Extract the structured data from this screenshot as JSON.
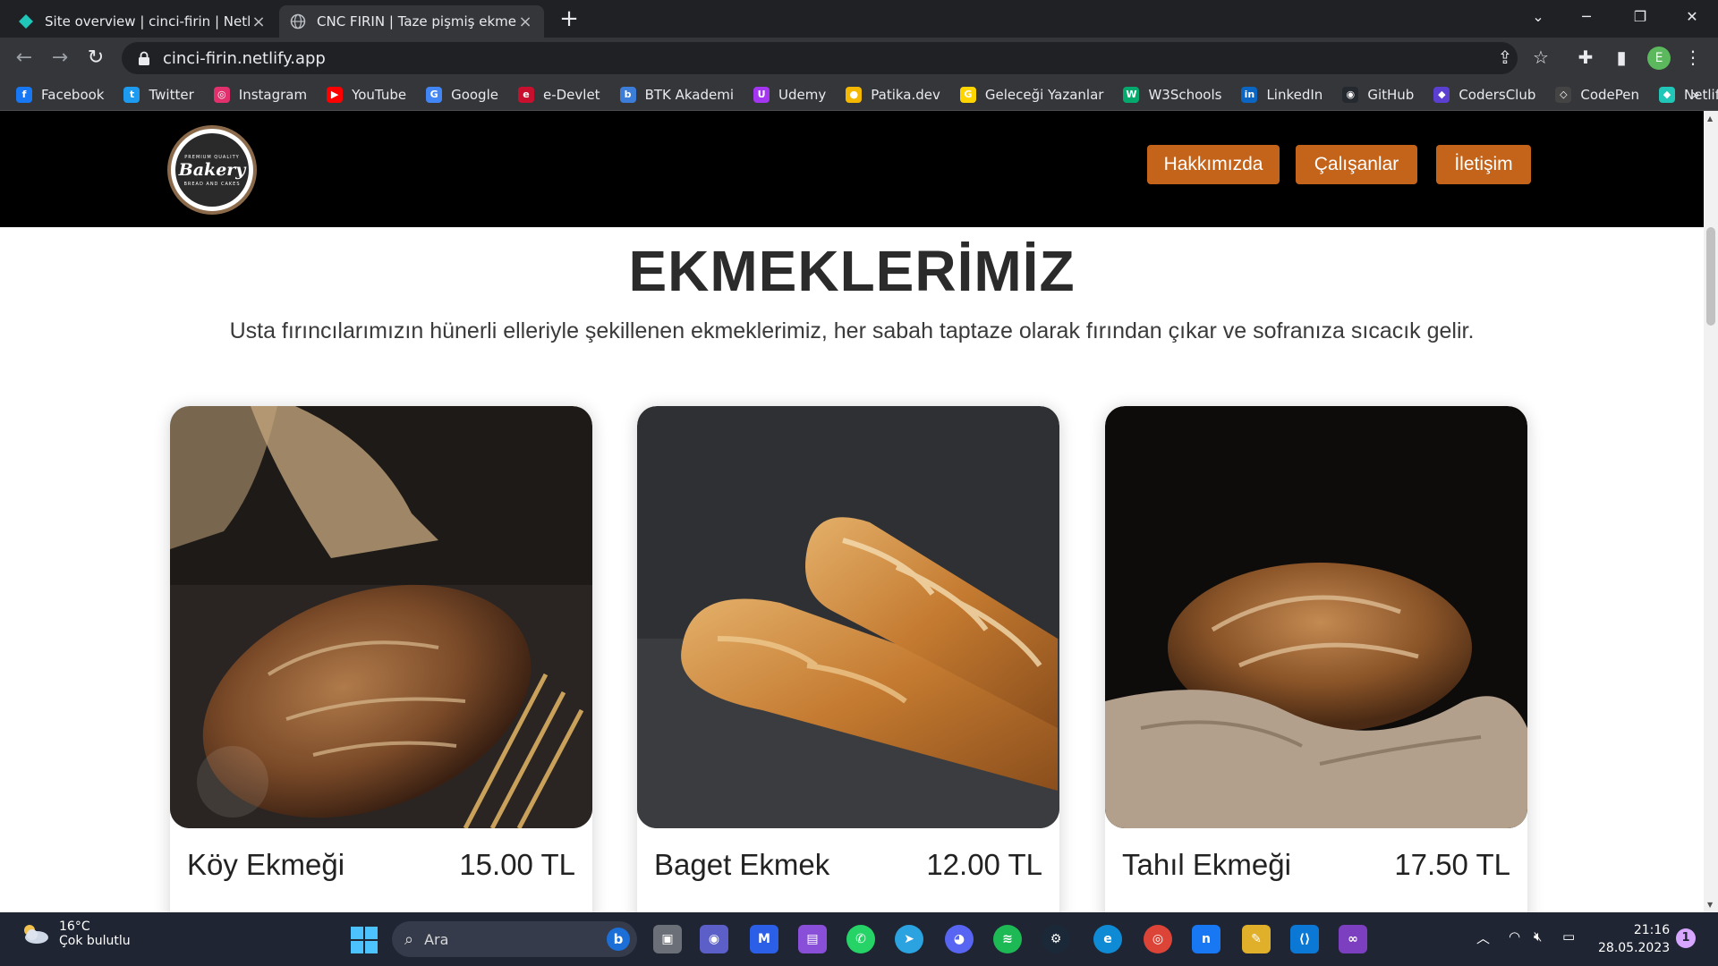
{
  "browser": {
    "tabs": [
      {
        "title": "Site overview | cinci-firin | Netlify",
        "active": false
      },
      {
        "title": "CNC FIRIN | Taze pişmiş ekmekler",
        "active": true
      }
    ],
    "url": "cinci-firin.netlify.app",
    "profile_initial": "E",
    "bookmarks": [
      {
        "label": "Facebook",
        "icon": "facebook-icon",
        "color": "#1877f2",
        "glyph": "f"
      },
      {
        "label": "Twitter",
        "icon": "twitter-icon",
        "color": "#1d9bf0",
        "glyph": "t"
      },
      {
        "label": "Instagram",
        "icon": "instagram-icon",
        "color": "#e1306c",
        "glyph": "◎"
      },
      {
        "label": "YouTube",
        "icon": "youtube-icon",
        "color": "#ff0000",
        "glyph": "▶"
      },
      {
        "label": "Google",
        "icon": "google-icon",
        "color": "#4285f4",
        "glyph": "G"
      },
      {
        "label": "e-Devlet",
        "icon": "edevlet-icon",
        "color": "#c8102e",
        "glyph": "e"
      },
      {
        "label": "BTK Akademi",
        "icon": "btk-icon",
        "color": "#3b7dd8",
        "glyph": "b"
      },
      {
        "label": "Udemy",
        "icon": "udemy-icon",
        "color": "#a435f0",
        "glyph": "U"
      },
      {
        "label": "Patika.dev",
        "icon": "patika-icon",
        "color": "#f5b800",
        "glyph": "●"
      },
      {
        "label": "Geleceği Yazanlar",
        "icon": "gelecegi-yazanlar-icon",
        "color": "#ffd500",
        "glyph": "G"
      },
      {
        "label": "W3Schools",
        "icon": "w3schools-icon",
        "color": "#04aa6d",
        "glyph": "W"
      },
      {
        "label": "LinkedIn",
        "icon": "linkedin-icon",
        "color": "#0a66c2",
        "glyph": "in"
      },
      {
        "label": "GitHub",
        "icon": "github-icon",
        "color": "#24292f",
        "glyph": "◉"
      },
      {
        "label": "CodersClub",
        "icon": "codersclub-icon",
        "color": "#5b3fd1",
        "glyph": "◆"
      },
      {
        "label": "CodePen",
        "icon": "codepen-icon",
        "color": "#444444",
        "glyph": "◇"
      },
      {
        "label": "Netlify",
        "icon": "netlify-icon",
        "color": "#20c6b7",
        "glyph": "◆"
      }
    ],
    "bookmarks_more": "»"
  },
  "site": {
    "logo": {
      "script": "Bakery",
      "top_text": "PREMIUM QUALITY",
      "bottom_text": "BREAD AND CAKES"
    },
    "nav": [
      "Hakkımızda",
      "Çalışanlar",
      "İletişim"
    ],
    "nav_color": "#c4631a",
    "section_title": "EKMEKLERİMİZ",
    "section_subtitle": "Usta fırıncılarımızın hünerli elleriyle şekillenen ekmeklerimiz, her sabah taptaze olarak fırından çıkar ve sofranıza sıcacık gelir.",
    "products": [
      {
        "name": "Köy Ekmeği",
        "price": "15.00 TL",
        "image": "country-bread-photo"
      },
      {
        "name": "Baget Ekmek",
        "price": "12.00 TL",
        "image": "baguette-photo"
      },
      {
        "name": "Tahıl Ekmeği",
        "price": "17.50 TL",
        "image": "grain-bread-photo"
      }
    ]
  },
  "taskbar": {
    "weather_temp": "16°C",
    "weather_desc": "Çok bulutlu",
    "search_placeholder": "Ara",
    "time": "21:16",
    "date": "28.05.2023",
    "notification_count": "1"
  }
}
